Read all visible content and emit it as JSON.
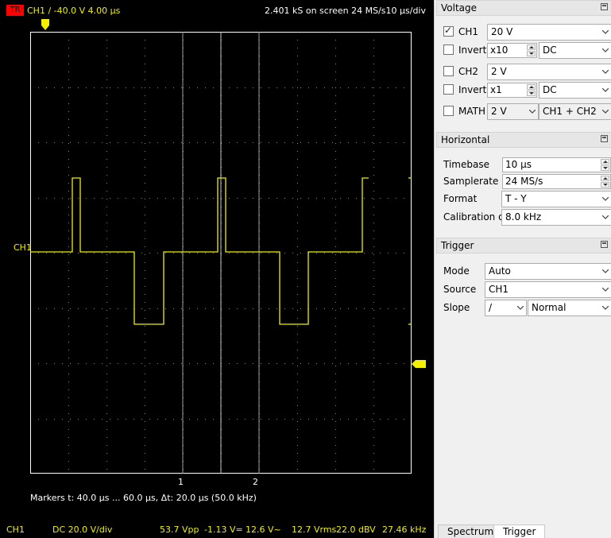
{
  "scope": {
    "header": {
      "trigger_badge": "TR",
      "ch1_info": "CH1  /  -40.0 V  4.00 µs",
      "acquisition_info": "2.401 kS on screen 24 MS/s10 µs/div"
    },
    "ch1_label": "CH1",
    "cursor_labels": [
      "1",
      "2"
    ],
    "markers_text": "Markers   t: 40.0 µs ... 60.0 µs,  Δt: 20.0 µs (50.0 kHz)",
    "status": {
      "channel": "CH1",
      "coupling_scale": "DC   20.0 V/div",
      "vpp": "53.7 Vpp",
      "vdc": "-1.13 V=",
      "vac": "12.6 V~",
      "vrms": "12.7 Vrms",
      "dbv": "22.0 dBV",
      "freq": "27.46 kHz"
    },
    "colors": {
      "trace": "#f0f000",
      "grid": "#777777",
      "border": "#ffffff",
      "badge": "#ff0000"
    }
  },
  "voltage": {
    "title": "Voltage",
    "ch1": {
      "checked": true,
      "label": "CH1",
      "gain": "20 V"
    },
    "ch1_invert": {
      "checked": false,
      "label": "Invert",
      "probe": "x10",
      "coupling": "DC"
    },
    "ch2": {
      "checked": false,
      "label": "CH2",
      "gain": "2 V"
    },
    "ch2_invert": {
      "checked": false,
      "label": "Invert",
      "probe": "x1",
      "coupling": "DC"
    },
    "math": {
      "checked": false,
      "label": "MATH",
      "gain": "2 V",
      "mode": "CH1 + CH2"
    }
  },
  "horizontal": {
    "title": "Horizontal",
    "timebase_label": "Timebase",
    "timebase": "10 µs",
    "samplerate_label": "Samplerate",
    "samplerate": "24 MS/s",
    "format_label": "Format",
    "format": "T - Y",
    "calibration_label": "Calibration out",
    "calibration": "8.0 kHz"
  },
  "trigger": {
    "title": "Trigger",
    "mode_label": "Mode",
    "mode": "Auto",
    "source_label": "Source",
    "source": "CH1",
    "slope_label": "Slope",
    "slope": "/",
    "type": "Normal"
  },
  "tabs": [
    "Spectrum",
    "Trigger"
  ],
  "icons": {
    "float": "float-icon",
    "dropdown": "chevron-down-icon",
    "spin": "spin-arrows-icon"
  }
}
